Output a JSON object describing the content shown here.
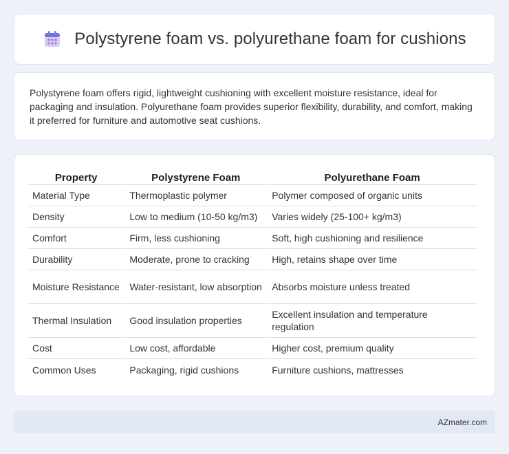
{
  "header": {
    "title": "Polystyrene foam vs. polyurethane foam for cushions",
    "icon": "calendar-icon"
  },
  "intro": {
    "text": "Polystyrene foam offers rigid, lightweight cushioning with excellent moisture resistance, ideal for packaging and insulation. Polyurethane foam provides superior flexibility, durability, and comfort, making it preferred for furniture and automotive seat cushions."
  },
  "table": {
    "headers": [
      "Property",
      "Polystyrene Foam",
      "Polyurethane Foam"
    ],
    "rows": [
      [
        "Material Type",
        "Thermoplastic polymer",
        "Polymer composed of organic units"
      ],
      [
        "Density",
        "Low to medium (10-50 kg/m3)",
        "Varies widely (25-100+ kg/m3)"
      ],
      [
        "Comfort",
        "Firm, less cushioning",
        "Soft, high cushioning and resilience"
      ],
      [
        "Durability",
        "Moderate, prone to cracking",
        "High, retains shape over time"
      ],
      [
        "Moisture Resistance",
        "Water-resistant, low absorption",
        "Absorbs moisture unless treated"
      ],
      [
        "Thermal Insulation",
        "Good insulation properties",
        "Excellent insulation and temperature regulation"
      ],
      [
        "Cost",
        "Low cost, affordable",
        "Higher cost, premium quality"
      ],
      [
        "Common Uses",
        "Packaging, rigid cushions",
        "Furniture cushions, mattresses"
      ]
    ]
  },
  "footer": {
    "brand": "AZmater.com"
  }
}
